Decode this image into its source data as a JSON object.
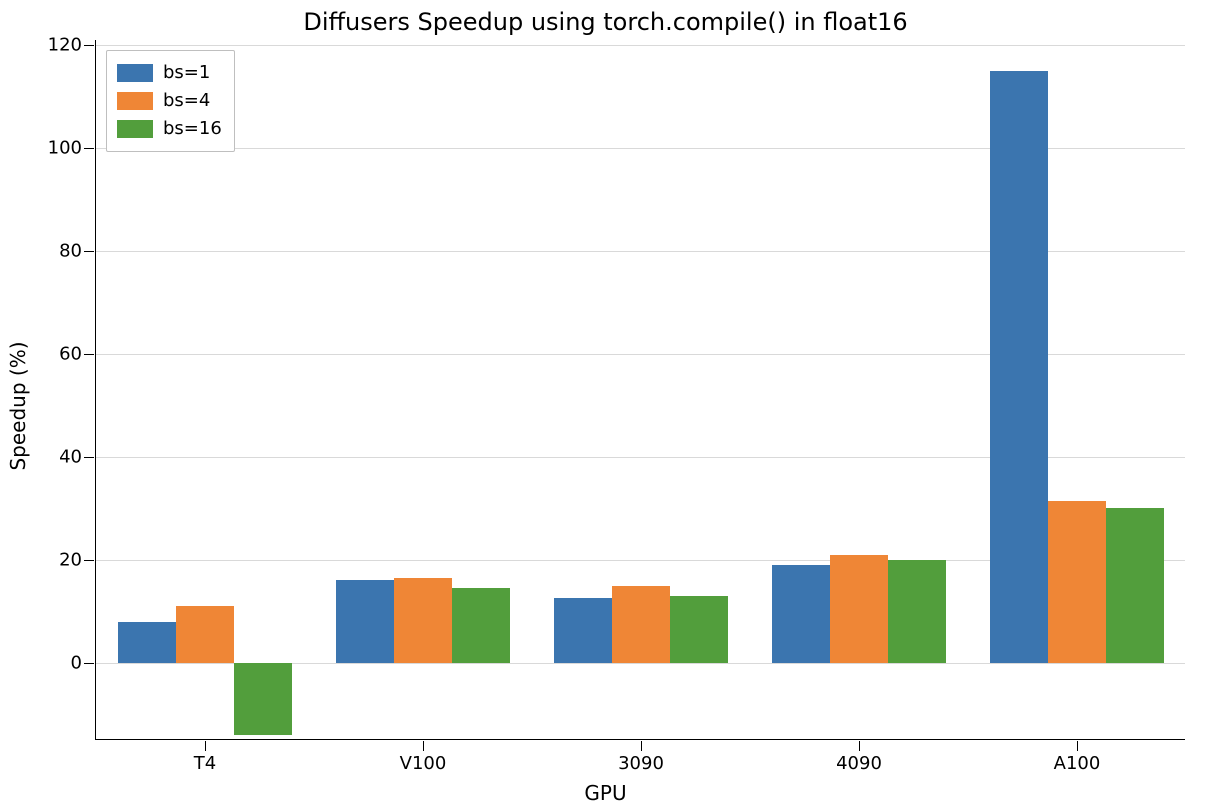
{
  "chart_data": {
    "type": "bar",
    "title": "Diffusers Speedup using torch.compile() in float16",
    "xlabel": "GPU",
    "ylabel": "Speedup (%)",
    "ylim": [
      -15,
      121
    ],
    "y_ticks": [
      0,
      20,
      40,
      60,
      80,
      100,
      120
    ],
    "categories": [
      "T4",
      "V100",
      "3090",
      "4090",
      "A100"
    ],
    "series": [
      {
        "name": "bs=1",
        "color": "#3b75af",
        "values": [
          8,
          16,
          12.5,
          19,
          115
        ]
      },
      {
        "name": "bs=4",
        "color": "#ef8636",
        "values": [
          11,
          16.5,
          15,
          21,
          31.5
        ]
      },
      {
        "name": "bs=16",
        "color": "#529e3c",
        "values": [
          -14,
          14.5,
          13,
          20,
          30
        ]
      }
    ],
    "legend_position": "upper-left",
    "grid": true
  },
  "title": "Diffusers Speedup using torch.compile() in float16",
  "xlabel": "GPU",
  "ylabel": "Speedup (%)",
  "legend": {
    "items": [
      {
        "label": "bs=1"
      },
      {
        "label": "bs=4"
      },
      {
        "label": "bs=16"
      }
    ]
  },
  "y_ticks": [
    {
      "label": "0",
      "value": 0
    },
    {
      "label": "20",
      "value": 20
    },
    {
      "label": "40",
      "value": 40
    },
    {
      "label": "60",
      "value": 60
    },
    {
      "label": "80",
      "value": 80
    },
    {
      "label": "100",
      "value": 100
    },
    {
      "label": "120",
      "value": 120
    }
  ],
  "x_ticks": [
    {
      "label": "T4"
    },
    {
      "label": "V100"
    },
    {
      "label": "3090"
    },
    {
      "label": "4090"
    },
    {
      "label": "A100"
    }
  ]
}
